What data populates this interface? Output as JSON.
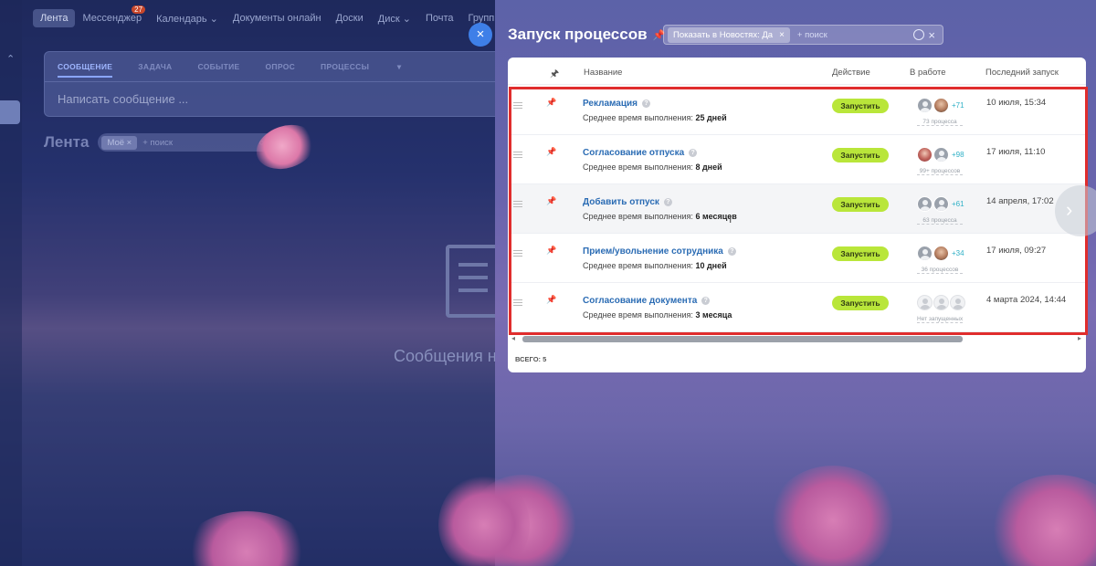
{
  "background_nav": {
    "items": [
      "Лента",
      "Мессенджер",
      "Календарь",
      "Документы онлайн",
      "Доски",
      "Диск",
      "Почта",
      "Группы"
    ],
    "messenger_badge": "27"
  },
  "composer": {
    "tabs": [
      "СООБЩЕНИЕ",
      "ЗАДАЧА",
      "СОБЫТИЕ",
      "ОПРОС",
      "ПРОЦЕССЫ"
    ],
    "placeholder": "Написать сообщение ..."
  },
  "feed": {
    "title": "Лента",
    "filter_tag": "Моё",
    "search_placeholder": "+ поиск",
    "empty_message": "Сообщения н"
  },
  "panel": {
    "close_label": "×",
    "title": "Запуск процессов",
    "filter_chip": "Показать в Новостях: Да",
    "search_placeholder": "+ поиск",
    "columns": {
      "name": "Название",
      "action": "Действие",
      "in_work": "В работе",
      "last_run": "Последний запуск"
    },
    "run_label": "Запустить",
    "duration_prefix": "Среднее время выполнения:",
    "rows": [
      {
        "name": "Рекламация",
        "duration": "25 дней",
        "plus": "+71",
        "count": "73 процесса",
        "last": "10 июля, 15:34",
        "avatars": [
          "generic",
          "photo"
        ]
      },
      {
        "name": "Согласование отпуска",
        "duration": "8 дней",
        "plus": "+98",
        "count": "99+ процессов",
        "last": "17 июля, 11:10",
        "avatars": [
          "photo2",
          "generic"
        ]
      },
      {
        "name": "Добавить отпуск",
        "duration": "6 месяцев",
        "plus": "+61",
        "count": "63 процесса",
        "last": "14 апреля, 17:02",
        "avatars": [
          "generic",
          "generic"
        ]
      },
      {
        "name": "Прием/увольнение сотрудника",
        "duration": "10 дней",
        "plus": "+34",
        "count": "36 процессов",
        "last": "17 июля, 09:27",
        "avatars": [
          "generic",
          "photo"
        ]
      },
      {
        "name": "Согласование документа",
        "duration": "3 месяца",
        "plus": "",
        "count": "Нет запущенных",
        "last": "4 марта 2024, 14:44",
        "avatars": [
          "ghost",
          "ghost",
          "ghost"
        ]
      }
    ],
    "total": "ВСЕГО: 5",
    "next_icon": "chevron-right-icon"
  },
  "colors": {
    "run_button": "#b9e63a",
    "link": "#2b6cb4",
    "highlight_frame": "#e02d2d",
    "close_button": "#3e7fe8"
  }
}
